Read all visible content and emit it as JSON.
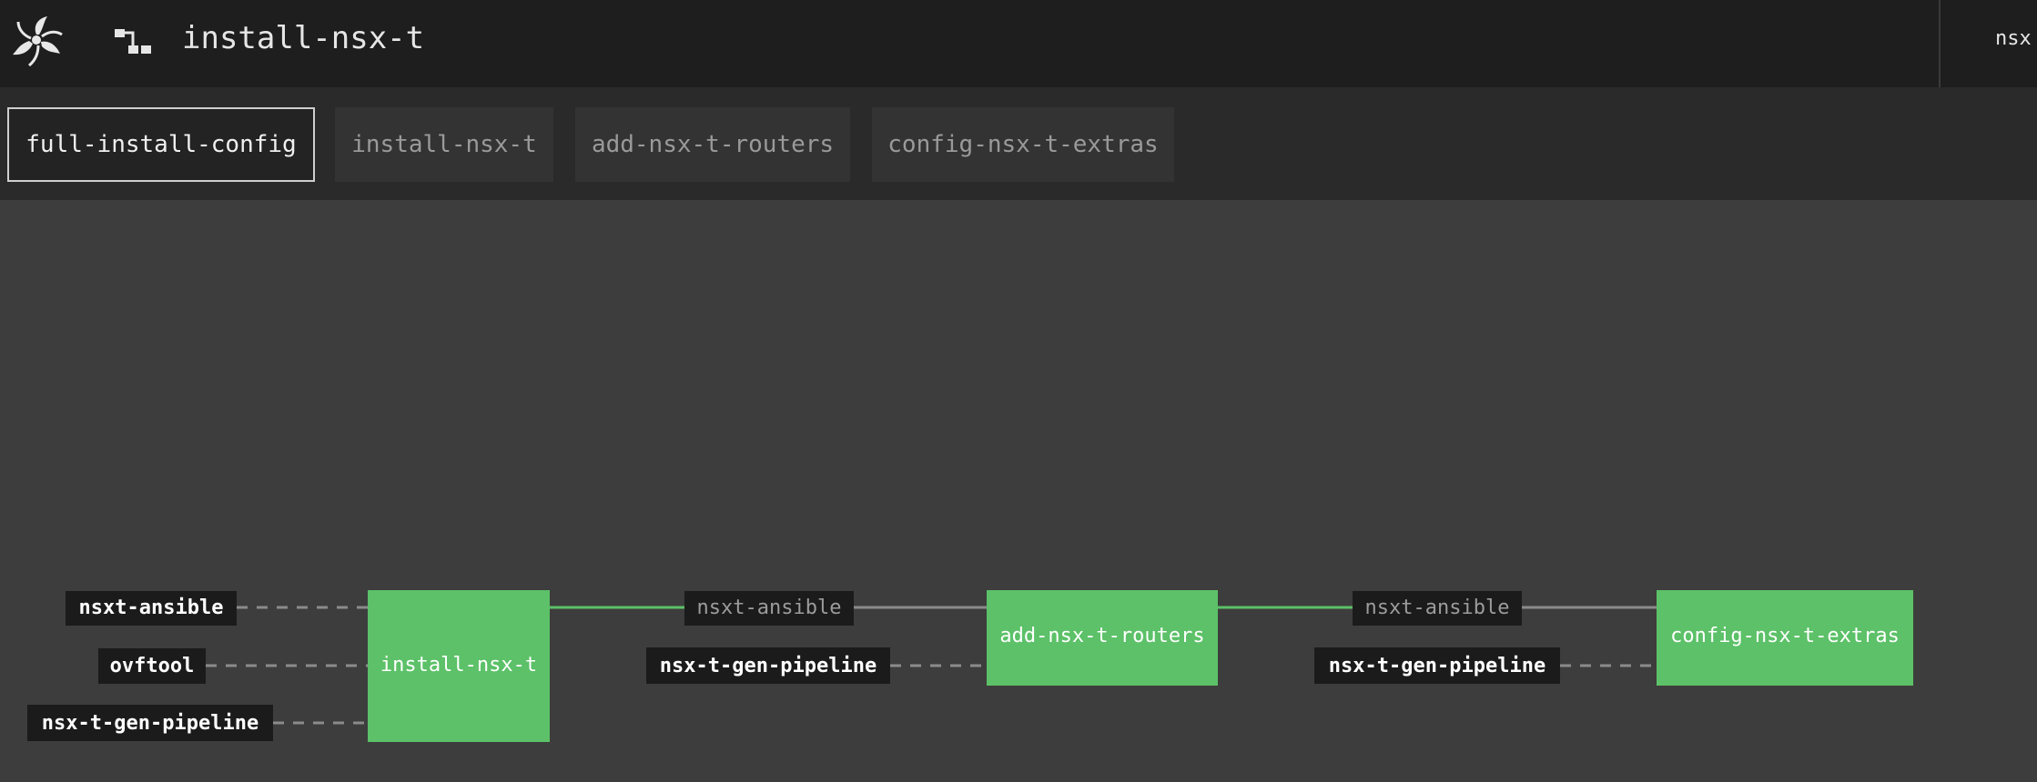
{
  "header": {
    "pipeline_name": "install-nsx-t",
    "team_name": "nsx"
  },
  "groups": [
    {
      "label": "full-install-config",
      "active": true
    },
    {
      "label": "install-nsx-t",
      "active": false
    },
    {
      "label": "add-nsx-t-routers",
      "active": false
    },
    {
      "label": "config-nsx-t-extras",
      "active": false
    }
  ],
  "graph": {
    "jobs": [
      {
        "name": "install-nsx-t",
        "status": "succeeded"
      },
      {
        "name": "add-nsx-t-routers",
        "status": "succeeded"
      },
      {
        "name": "config-nsx-t-extras",
        "status": "succeeded"
      }
    ],
    "inputs": {
      "install_nsx_t": [
        "nsxt-ansible",
        "ovftool",
        "nsx-t-gen-pipeline"
      ],
      "add_nsx_t_routers": [
        "nsxt-ansible",
        "nsx-t-gen-pipeline"
      ],
      "config_nsx_t_extras": [
        "nsxt-ansible",
        "nsx-t-gen-pipeline"
      ]
    }
  },
  "colors": {
    "succeeded": "#5cc168",
    "background": "#3d3d3d",
    "header": "#1e1e1e",
    "group_bar": "#2a2a2a",
    "resource_box": "#1b1b1b"
  }
}
